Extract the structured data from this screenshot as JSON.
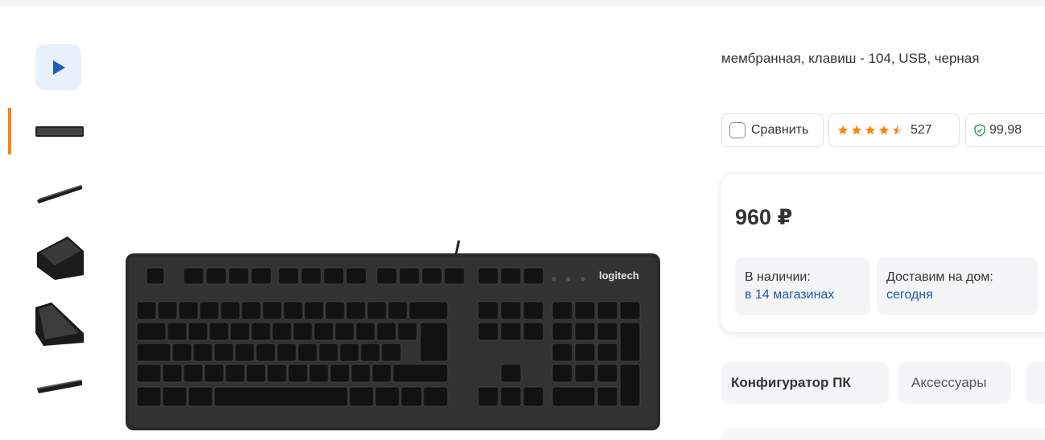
{
  "product": {
    "description": "мембранная, клавиш - 104, USB, черная",
    "brand_on_image": "logitech"
  },
  "actions": {
    "compare_label": "Сравнить",
    "rating_value": 4.5,
    "rating_count": "527",
    "reliability": "99,98"
  },
  "pricing": {
    "price": "960 ₽",
    "availability_label": "В наличии:",
    "availability_value": "в 14 магазинах",
    "delivery_label": "Доставим на дом:",
    "delivery_value": "сегодня"
  },
  "tabs": [
    {
      "label": "Конфигуратор ПК"
    },
    {
      "label": "Аксессуары"
    }
  ],
  "colors": {
    "accent_orange": "#fc8507",
    "link_blue": "#1e5aa8",
    "play_bg": "#e8f0fb",
    "play_icon": "#1a5fb4",
    "reliability_green": "#2e9b4f"
  },
  "gallery": {
    "thumbnails": [
      "keyboard-top-view",
      "keyboard-side-view",
      "keyboard-angle-view",
      "keyboard-angle-left-view",
      "keyboard-profile-view"
    ],
    "active_index": 0
  }
}
